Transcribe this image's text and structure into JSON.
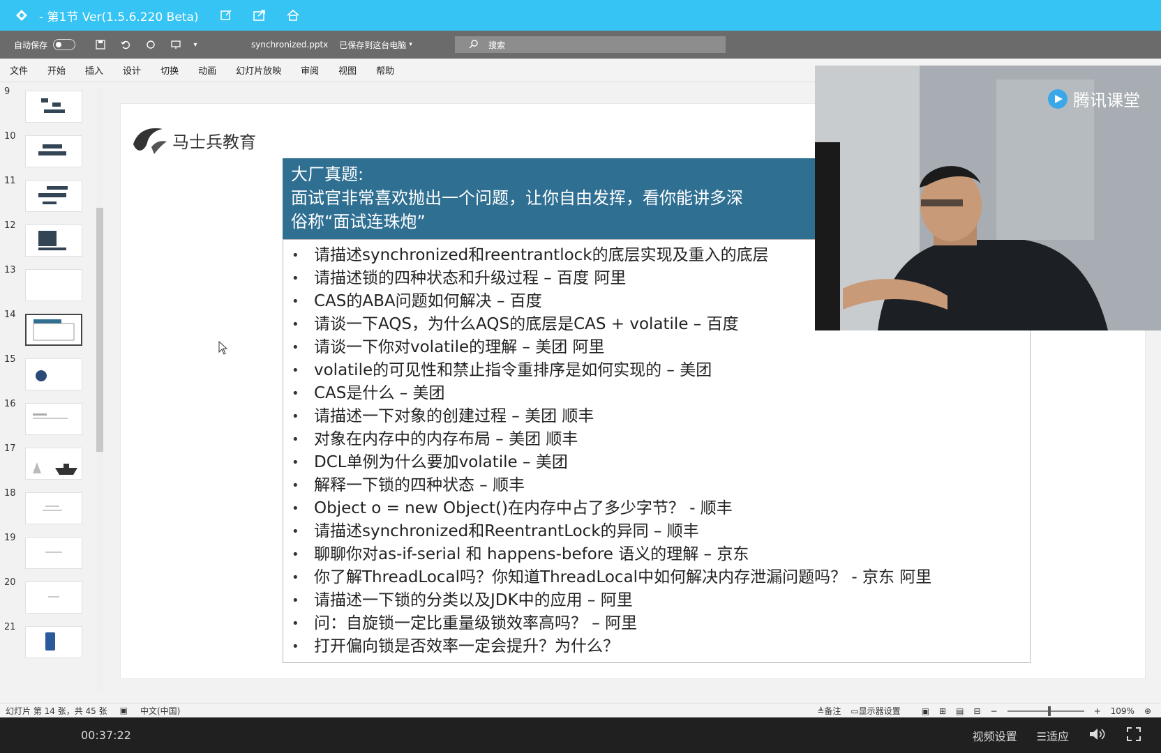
{
  "titlebar": {
    "title": "- 第1节 Ver(1.5.6.220 Beta)",
    "icons": [
      "edit-icon",
      "share-icon",
      "home-icon"
    ]
  },
  "ppt": {
    "autosave_label": "自动保存",
    "filename": "synchronized.pptx",
    "save_status": "已保存到这台电脑",
    "search_placeholder": "搜索",
    "menu": [
      "文件",
      "开始",
      "插入",
      "设计",
      "切换",
      "动画",
      "幻灯片放映",
      "审阅",
      "视图",
      "帮助"
    ]
  },
  "thumbnails": [
    {
      "num": "9"
    },
    {
      "num": "10"
    },
    {
      "num": "11"
    },
    {
      "num": "12"
    },
    {
      "num": "13"
    },
    {
      "num": "14",
      "active": true
    },
    {
      "num": "15"
    },
    {
      "num": "16"
    },
    {
      "num": "17"
    },
    {
      "num": "18"
    },
    {
      "num": "19"
    },
    {
      "num": "20"
    },
    {
      "num": "21"
    }
  ],
  "slide": {
    "brand": "马士兵教育",
    "banner": {
      "line1": "大厂真题:",
      "line2": "面试官非常喜欢抛出一个问题，让你自由发挥，看你能讲多深",
      "line3_prefix": "俗称",
      "line3_quote": "“面试连珠炮”"
    },
    "questions": [
      "请描述synchronized和reentrantlock的底层实现及重入的底层",
      "请描述锁的四种状态和升级过程 – 百度 阿里",
      "CAS的ABA问题如何解决 – 百度",
      "请谈一下AQS，为什么AQS的底层是CAS + volatile – 百度",
      "请谈一下你对volatile的理解 – 美团 阿里",
      "volatile的可见性和禁止指令重排序是如何实现的 – 美团",
      "CAS是什么 – 美团",
      "请描述一下对象的创建过程 – 美团 顺丰",
      "对象在内存中的内存布局 – 美团 顺丰",
      "DCL单例为什么要加volatile – 美团",
      "解释一下锁的四种状态 – 顺丰",
      "Object o = new Object()在内存中占了多少字节？ - 顺丰",
      "请描述synchronized和ReentrantLock的异同 – 顺丰",
      "聊聊你对as-if-serial 和 happens-before 语义的理解 – 京东",
      "你了解ThreadLocal吗？你知道ThreadLocal中如何解决内存泄漏问题吗？ - 京东 阿里",
      "请描述一下锁的分类以及JDK中的应用 – 阿里",
      "问：自旋锁一定比重量级锁效率高吗？ – 阿里",
      "打开偏向锁是否效率一定会提升？为什么？"
    ]
  },
  "webcam": {
    "brand": "腾讯课堂"
  },
  "statusbar": {
    "slide_info": "幻灯片 第 14 张，共 45 张",
    "language": "中文(中国)",
    "notes": "备注",
    "display_settings": "显示器设置",
    "zoom_minus": "−",
    "zoom_plus": "+",
    "zoom": "109%"
  },
  "player": {
    "time": "00:37:22",
    "video_settings": "视频设置",
    "fit": "☰适应"
  },
  "colors": {
    "titlebar": "#35c4f4",
    "banner": "#2f6f92",
    "qat": "#6b6b6b"
  }
}
